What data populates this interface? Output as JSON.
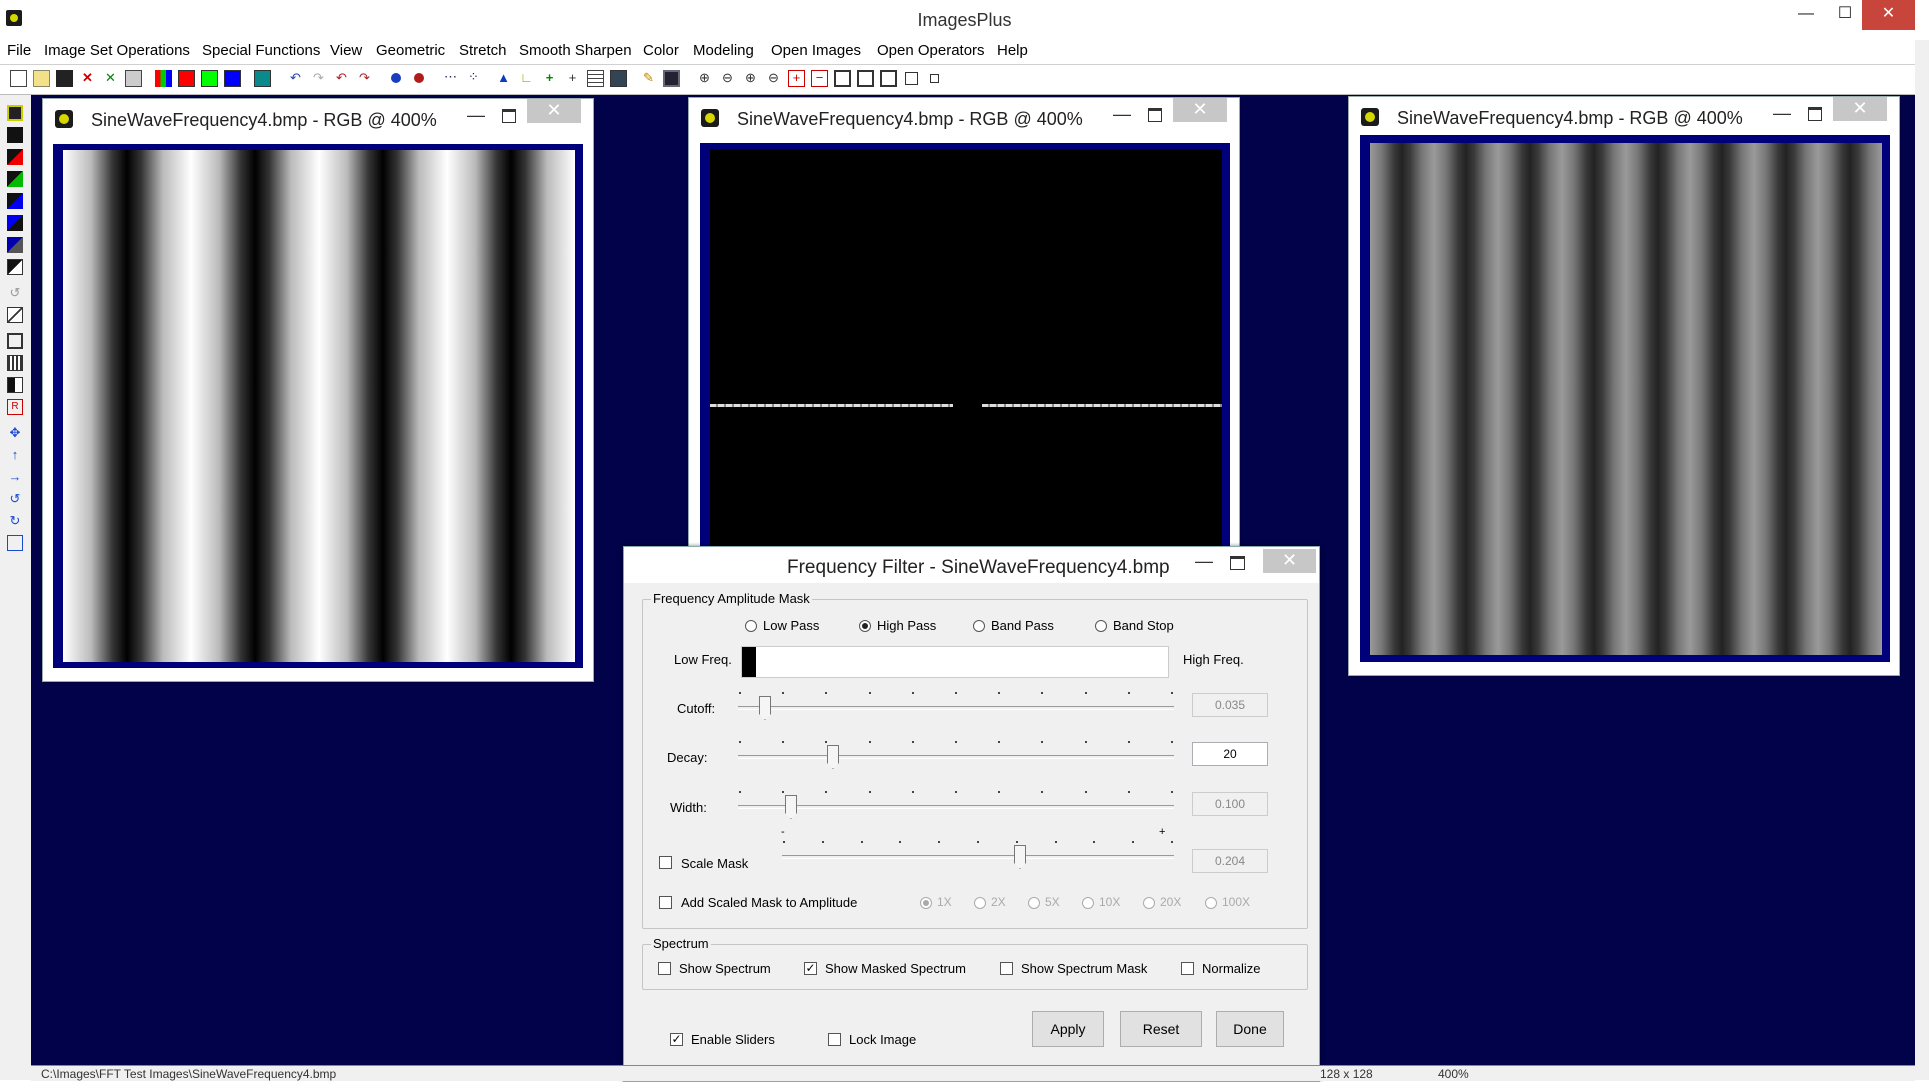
{
  "app": {
    "title": "ImagesPlus"
  },
  "menu": [
    "File",
    "Image Set Operations",
    "Special Functions",
    "View",
    "Geometric",
    "Stretch",
    "Smooth Sharpen",
    "Color",
    "Modeling",
    "Open Images",
    "Open Operators",
    "Help"
  ],
  "image_windows": [
    {
      "title": "SineWaveFrequency4.bmp - RGB @ 400%"
    },
    {
      "title": "SineWaveFrequency4.bmp - RGB @ 400%"
    },
    {
      "title": "SineWaveFrequency4.bmp - RGB @ 400%"
    }
  ],
  "window_controls": {
    "minimize": "—",
    "maximize": "☐",
    "close": "✕"
  },
  "dialog": {
    "title": "Frequency Filter - SineWaveFrequency4.bmp",
    "amp_group": "Frequency Amplitude Mask",
    "filter_types": [
      "Low Pass",
      "High Pass",
      "Band Pass",
      "Band Stop"
    ],
    "selected_filter": "High Pass",
    "low_freq": "Low Freq.",
    "high_freq": "High Freq.",
    "cutoff_label": "Cutoff:",
    "cutoff_value": "0.035",
    "decay_label": "Decay:",
    "decay_value": "20",
    "width_label": "Width:",
    "width_value": "0.100",
    "scale_mask_label": "Scale Mask",
    "scale_value": "0.204",
    "scale_minus": "-",
    "scale_plus": "+",
    "add_scaled_label": "Add Scaled Mask to Amplitude",
    "multipliers": [
      "1X",
      "2X",
      "5X",
      "10X",
      "20X",
      "100X"
    ],
    "spectrum_group": "Spectrum",
    "show_spectrum": "Show Spectrum",
    "show_masked": "Show Masked Spectrum",
    "show_mask": "Show Spectrum Mask",
    "normalize": "Normalize",
    "enable_sliders": "Enable Sliders",
    "lock_image": "Lock Image",
    "apply": "Apply",
    "reset": "Reset",
    "done": "Done",
    "check_mark": "✓"
  },
  "slider_levels": {
    "cutoff": 0.05,
    "decay": 0.21,
    "width": 0.11,
    "scale": 0.61
  },
  "status": {
    "path": "C:\\Images\\FFT Test Images\\SineWaveFrequency4.bmp",
    "size": "128 x 128",
    "zoom": "400%"
  },
  "colors": {
    "mdi_bg": "#02024a",
    "frame": "#00007a",
    "close_red": "#c7453b"
  }
}
